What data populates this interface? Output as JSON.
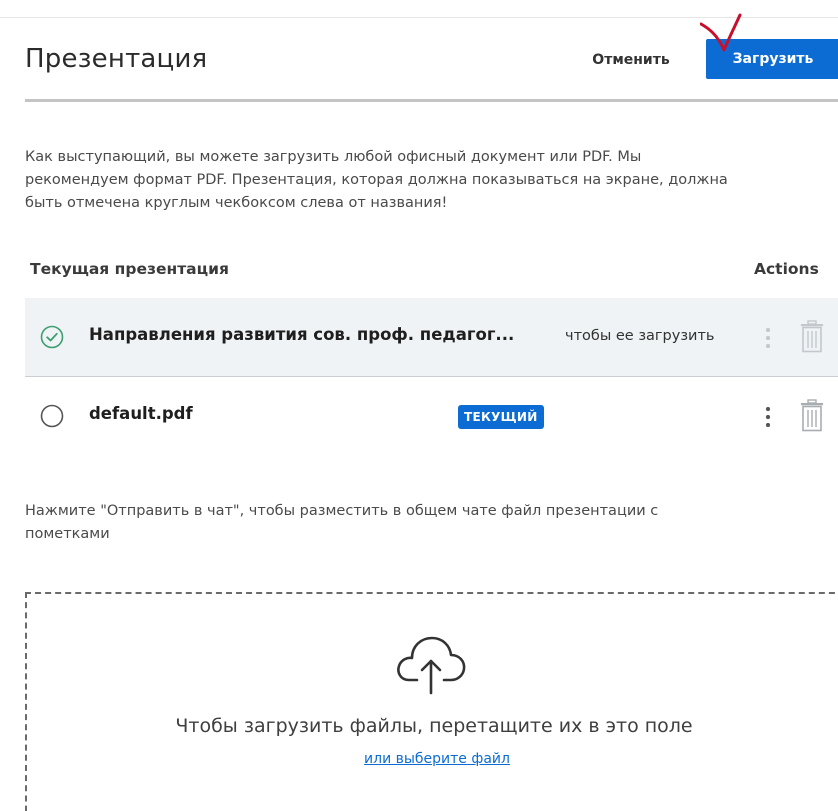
{
  "header": {
    "title": "Презентация",
    "cancel_label": "Отменить",
    "upload_label": "Загрузить"
  },
  "intro": {
    "line1": "Как выступающий, вы можете загрузить любой офисный документ или PDF. Мы",
    "line2": "рекомендуем формат PDF. Презентация, которая должна показываться на экране, должна",
    "line3": "быть отмечена круглым чекбоксом слева от названия!"
  },
  "table": {
    "col_current": "Текущая презентация",
    "col_actions": "Actions",
    "rows": [
      {
        "name": "Направления развития сов. проф. педагог...",
        "hint": "чтобы ее загрузить",
        "selected": true
      },
      {
        "name": "default.pdf",
        "badge": "ТЕКУЩИЙ",
        "selected": false
      }
    ]
  },
  "chat_note": {
    "line1": "Нажмите \"Отправить в чат\", чтобы разместить в общем чате файл презентации с",
    "line2": "пометками"
  },
  "dropzone": {
    "text": "Чтобы загрузить файлы, перетащите их в это поле",
    "link": "или выберите файл"
  },
  "colors": {
    "accent": "#0c6cd4",
    "selected_row_bg": "#eff3f5",
    "check_green": "#3a9e6e",
    "annotation_red": "#c8102e"
  },
  "icons": {
    "selected_radio": "check-circle-icon",
    "unselected_radio": "radio-empty-icon",
    "menu": "kebab-menu-icon",
    "delete": "trash-icon",
    "upload": "cloud-upload-icon",
    "annotation": "red-check-mark"
  }
}
